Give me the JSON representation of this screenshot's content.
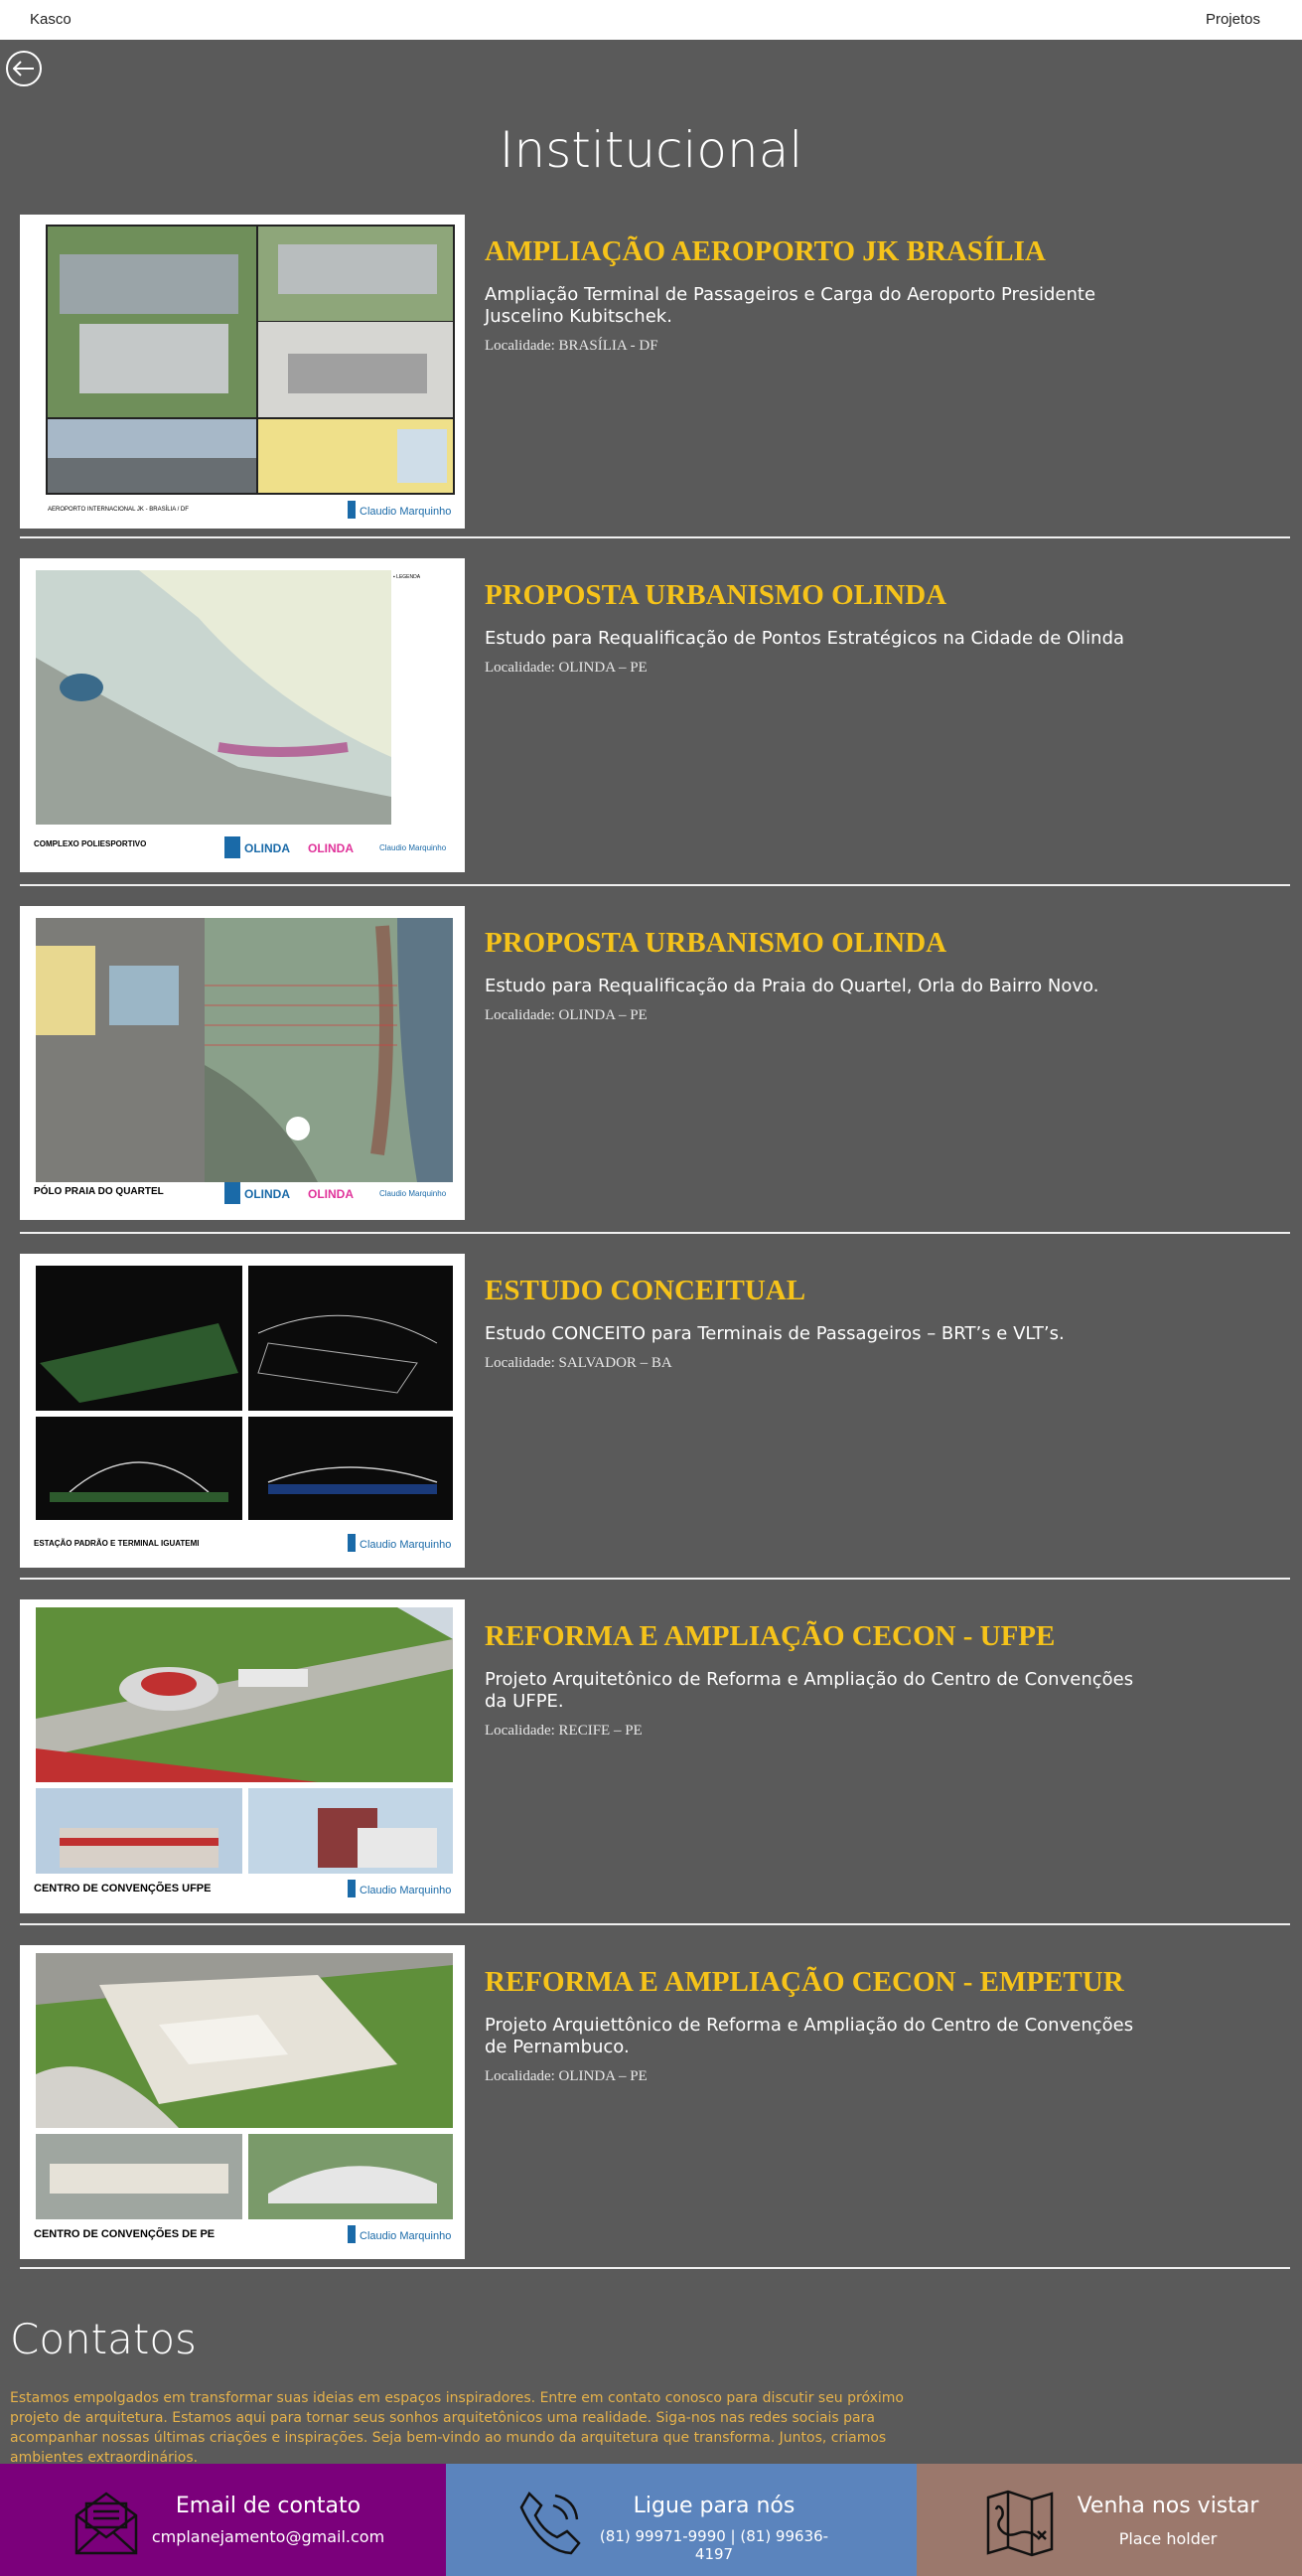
{
  "header": {
    "brand": "Kasco",
    "nav_projects": "Projetos"
  },
  "back_icon": "arrow-left-icon",
  "page_title": "Institucional",
  "projects": [
    {
      "title": "AMPLIAÇÃO AEROPORTO JK BRASÍLIA",
      "description": "Ampliação Terminal de Passageiros e Carga do Aeroporto Presidente Juscelino Kubitschek.",
      "location": "Localidade: BRASÍLIA - DF",
      "image_caption": "AEROPORTO INTERNACIONAL JK - BRASÍLIA / DF",
      "image_brand": "Claudio Marquinho"
    },
    {
      "title": "PROPOSTA URBANISMO OLINDA",
      "description": "Estudo para Requalificação de Pontos Estratégicos na Cidade de Olinda",
      "location": "Localidade: OLINDA – PE",
      "image_caption": "COMPLEXO POLIESPORTIVO",
      "image_brand": "Claudio Marquinho"
    },
    {
      "title": "PROPOSTA URBANISMO OLINDA",
      "description": "Estudo para Requalificação da Praia do Quartel, Orla do Bairro Novo.",
      "location": "Localidade: OLINDA – PE",
      "image_caption": "PÓLO PRAIA DO QUARTEL",
      "image_brand": "Claudio Marquinho"
    },
    {
      "title": "ESTUDO CONCEITUAL",
      "description": "Estudo CONCEITO para Terminais de Passageiros – BRT’s e VLT’s.",
      "location": "Localidade: SALVADOR – BA",
      "image_caption": "ESTAÇÃO PADRÃO E TERMINAL IGUATEMI",
      "image_brand": "Claudio Marquinho"
    },
    {
      "title": "REFORMA E AMPLIAÇÃO CECON - UFPE",
      "description": "Projeto Arquitetônico de Reforma e Ampliação do Centro de Convenções da UFPE.",
      "location": "Localidade: RECIFE – PE",
      "image_caption": "CENTRO DE CONVENÇÕES UFPE",
      "image_brand": "Claudio Marquinho"
    },
    {
      "title": "REFORMA E AMPLIAÇÃO CECON - EMPETUR",
      "description": "Projeto Arquiettônico de Reforma e Ampliação do Centro de Convenções de Pernambuco.",
      "location": "Localidade: OLINDA – PE",
      "image_caption": "CENTRO DE CONVENÇÕES DE PE",
      "image_brand": "Claudio Marquinho"
    }
  ],
  "contacts": {
    "title": "Contatos",
    "text": "Estamos empolgados em transformar suas ideias em espaços inspiradores. Entre em contato conosco para discutir seu próximo projeto de arquitetura. Estamos aqui para tornar seus sonhos arquitetônicos uma realidade. Siga-nos nas redes sociais para acompanhar nossas últimas criações e inspirações. Seja bem-vindo ao mundo da arquitetura que transforma. Juntos, criamos ambientes extraordinários.",
    "email": {
      "title": "Email de contato",
      "value": "cmplanejamento@gmail.com",
      "icon": "envelope-icon",
      "color": "#7b007b"
    },
    "phone": {
      "title": "Ligue para nós",
      "value": "(81) 99971-9990 | (81) 99636-4197",
      "icon": "phone-icon",
      "color": "#5b84bd"
    },
    "visit": {
      "title": "Venha nos vistar",
      "value": "Place holder",
      "icon": "map-icon",
      "color": "#9b786c"
    }
  },
  "colors": {
    "background": "#5a5a5a",
    "title_accent": "#f6c31a",
    "contact_text": "#e6b24a"
  }
}
